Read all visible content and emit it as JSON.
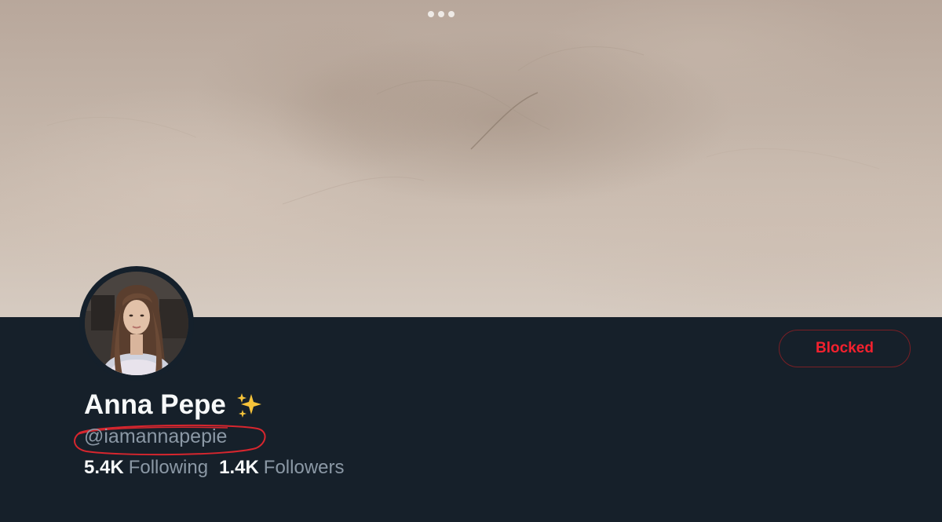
{
  "profile": {
    "display_name": "Anna Pepe",
    "name_emoji": "sparkles-icon",
    "handle": "@iamannapepie",
    "action_button_label": "Blocked"
  },
  "stats": {
    "following_count": "5.4K",
    "following_label": "Following",
    "followers_count": "1.4K",
    "followers_label": "Followers"
  },
  "colors": {
    "background": "#16202a",
    "blocked_red": "#f4212e",
    "annotation_red": "#d7262e",
    "secondary_text": "#8b98a5",
    "primary_text": "#f7f9f9"
  }
}
